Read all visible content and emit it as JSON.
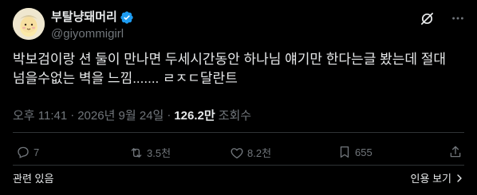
{
  "author": {
    "display_name": "부탈냥돼머리",
    "handle": "@giyommigirl",
    "verified": true
  },
  "post": {
    "text": "박보검이랑 션 둘이 만나면 두세시간동안 하나님 얘기만 한다는글 봤는데 절대 넘을수없는 벽을 느낌....... ㄹㅈㄷ달란트",
    "time": "오후 11:41",
    "separator": "·",
    "date": "2026년 9월 24일",
    "views_count": "126.2만",
    "views_label": "조회수"
  },
  "actions": {
    "replies": "7",
    "reposts": "3.5천",
    "likes": "8.2천",
    "bookmarks": "655"
  },
  "footer": {
    "related_label": "관련 있음",
    "quote_label": "인용 보기"
  },
  "colors": {
    "background": "#000000",
    "text": "#e7e9ea",
    "secondary": "#71767b",
    "verified": "#1d9bf0"
  },
  "icons": {
    "grok": "grok-icon",
    "more": "more-icon",
    "reply": "reply-icon",
    "repost": "repost-icon",
    "like": "like-icon",
    "bookmark": "bookmark-icon",
    "share": "share-icon",
    "related": "info-icon",
    "quote": "chevron-right-icon"
  }
}
